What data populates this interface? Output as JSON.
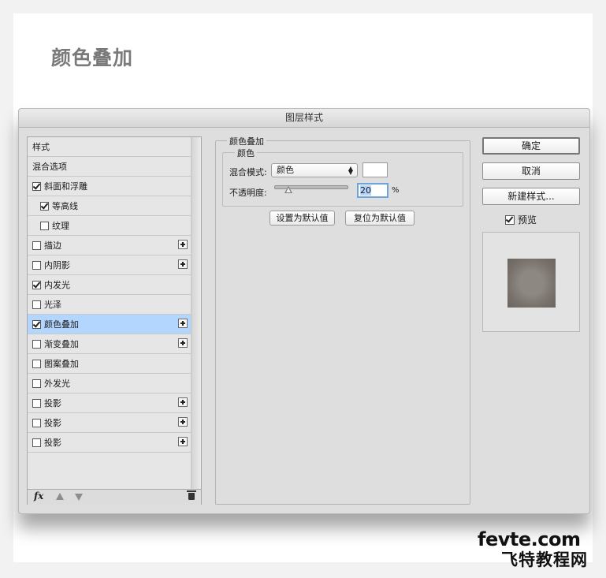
{
  "page": {
    "heading": "颜色叠加"
  },
  "dialog": {
    "title": "图层样式",
    "style_list": [
      {
        "label": "样式",
        "checkbox": false,
        "plus": false,
        "indent": false,
        "selected": false
      },
      {
        "label": "混合选项",
        "checkbox": false,
        "plus": false,
        "indent": false,
        "selected": false
      },
      {
        "label": "斜面和浮雕",
        "checkbox": true,
        "checked": true,
        "plus": false,
        "indent": false,
        "selected": false
      },
      {
        "label": "等高线",
        "checkbox": true,
        "checked": true,
        "plus": false,
        "indent": true,
        "selected": false
      },
      {
        "label": "纹理",
        "checkbox": true,
        "checked": false,
        "plus": false,
        "indent": true,
        "selected": false
      },
      {
        "label": "描边",
        "checkbox": true,
        "checked": false,
        "plus": true,
        "indent": false,
        "selected": false
      },
      {
        "label": "内阴影",
        "checkbox": true,
        "checked": false,
        "plus": true,
        "indent": false,
        "selected": false
      },
      {
        "label": "内发光",
        "checkbox": true,
        "checked": true,
        "plus": false,
        "indent": false,
        "selected": false
      },
      {
        "label": "光泽",
        "checkbox": true,
        "checked": false,
        "plus": false,
        "indent": false,
        "selected": false
      },
      {
        "label": "颜色叠加",
        "checkbox": true,
        "checked": true,
        "plus": true,
        "indent": false,
        "selected": true
      },
      {
        "label": "渐变叠加",
        "checkbox": true,
        "checked": false,
        "plus": true,
        "indent": false,
        "selected": false
      },
      {
        "label": "图案叠加",
        "checkbox": true,
        "checked": false,
        "plus": false,
        "indent": false,
        "selected": false
      },
      {
        "label": "外发光",
        "checkbox": true,
        "checked": false,
        "plus": false,
        "indent": false,
        "selected": false
      },
      {
        "label": "投影",
        "checkbox": true,
        "checked": false,
        "plus": true,
        "indent": false,
        "selected": false
      },
      {
        "label": "投影",
        "checkbox": true,
        "checked": false,
        "plus": true,
        "indent": false,
        "selected": false
      },
      {
        "label": "投影",
        "checkbox": true,
        "checked": false,
        "plus": true,
        "indent": false,
        "selected": false
      }
    ],
    "footer": {
      "fx_label": "fx"
    },
    "panel": {
      "legend": "颜色叠加",
      "sublegend": "颜色",
      "blend_mode_label": "混合模式:",
      "blend_mode_value": "颜色",
      "swatch_color": "#ffffff",
      "opacity_label": "不透明度:",
      "opacity_value": "20",
      "opacity_unit": "%",
      "opacity_level": 0.2,
      "set_default_label": "设置为默认值",
      "reset_default_label": "复位为默认值"
    },
    "buttons": {
      "ok": "确定",
      "cancel": "取消",
      "new_style": "新建样式..."
    },
    "preview": {
      "label": "预览",
      "checked": true
    }
  },
  "watermark": {
    "line1": "fevte.com",
    "line2": "飞特教程网"
  },
  "colors": {
    "selected_row": "#b3d6ff",
    "heading": "#7a7a7a"
  }
}
